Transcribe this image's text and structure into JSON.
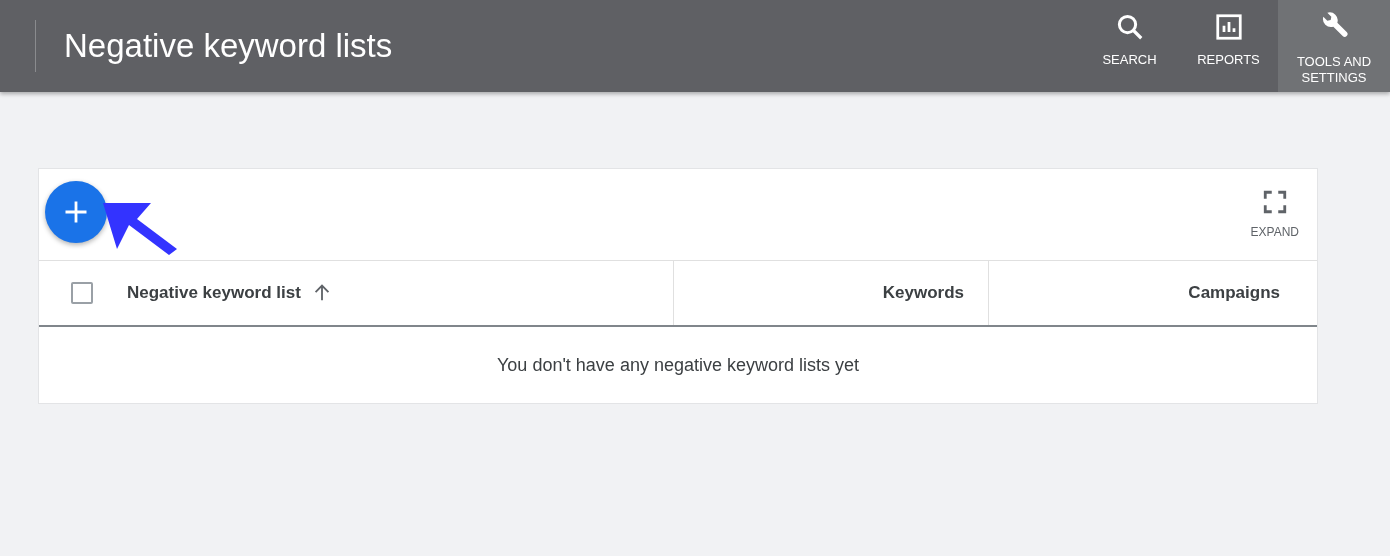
{
  "header": {
    "title": "Negative keyword lists",
    "nav": [
      {
        "kind": "search",
        "label": "SEARCH",
        "selected": false
      },
      {
        "kind": "reports",
        "label": "REPORTS",
        "selected": false
      },
      {
        "kind": "tools",
        "label": "TOOLS AND SETTINGS",
        "selected": true
      }
    ]
  },
  "toolbar": {
    "expand_label": "EXPAND"
  },
  "table": {
    "select_all": {
      "checked": false
    },
    "columns": [
      {
        "label": "Negative keyword list",
        "sorted": true
      },
      {
        "label": "Keywords",
        "sorted": false
      },
      {
        "label": "Campaigns",
        "sorted": false
      }
    ],
    "empty_message": "You don't have any negative keyword lists yet"
  }
}
